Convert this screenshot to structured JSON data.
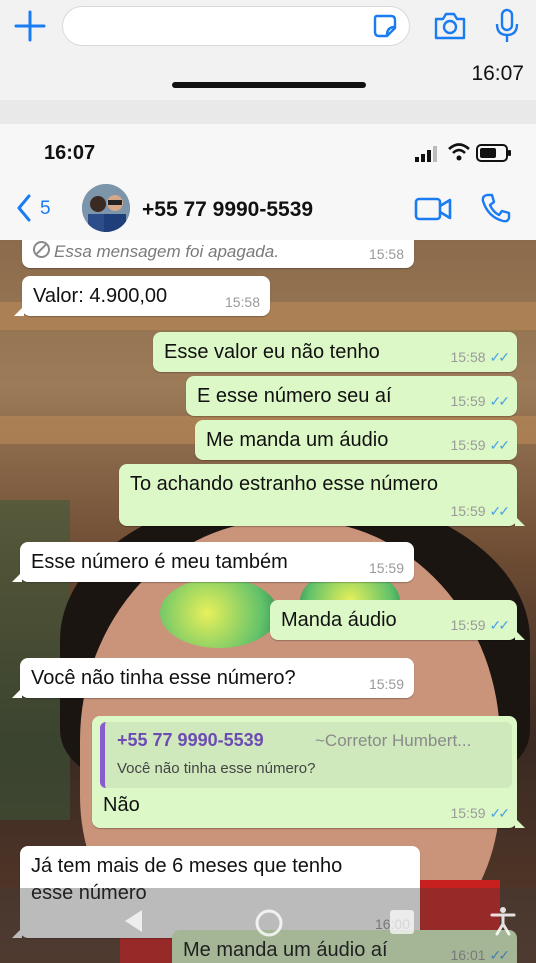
{
  "outer_bar": {
    "time": "16:07",
    "icons": [
      "plus-icon",
      "sticker-icon",
      "camera-icon",
      "microphone-icon"
    ],
    "accent": "#1a7cf2"
  },
  "status_bar": {
    "time": "16:07"
  },
  "chat_header": {
    "back_count": "5",
    "contact": "+55 77 9990-5539",
    "icons": [
      "back-chevron-icon",
      "video-call-icon",
      "voice-call-icon"
    ]
  },
  "messages": [
    {
      "dir": "in",
      "text": "Essa mensagem foi apagada.",
      "time": "15:58",
      "deleted": true
    },
    {
      "dir": "in",
      "text": "Valor: 4.900,00",
      "time": "15:58"
    },
    {
      "dir": "out",
      "text": "Esse valor eu não tenho",
      "time": "15:58"
    },
    {
      "dir": "out",
      "text": "E esse número seu aí",
      "time": "15:59"
    },
    {
      "dir": "out",
      "text": "Me manda um áudio",
      "time": "15:59"
    },
    {
      "dir": "out",
      "text": "To achando estranho esse número",
      "time": "15:59"
    },
    {
      "dir": "in",
      "text": "Esse número é meu também",
      "time": "15:59"
    },
    {
      "dir": "out",
      "text": "Manda áudio",
      "time": "15:59"
    },
    {
      "dir": "in",
      "text": "Você não tinha esse número?",
      "time": "15:59"
    },
    {
      "dir": "out",
      "text": "Não",
      "time": "15:59",
      "quote": {
        "name": "+55 77 9990-5539",
        "alias": "~Corretor Humbert...",
        "text": "Você não tinha esse número?"
      }
    },
    {
      "dir": "in",
      "text_line1": "Já tem mais de 6 meses que tenho",
      "text_line2": "esse número",
      "time": "16:00"
    },
    {
      "dir": "out",
      "text": "Me manda um áudio aí",
      "time": "16:01"
    }
  ],
  "colors": {
    "outgoing_bubble": "#dcf8c6",
    "incoming_bubble": "#ffffff",
    "read_ticks": "#4aa3e6",
    "quote_bar": "#8a5ad0"
  }
}
